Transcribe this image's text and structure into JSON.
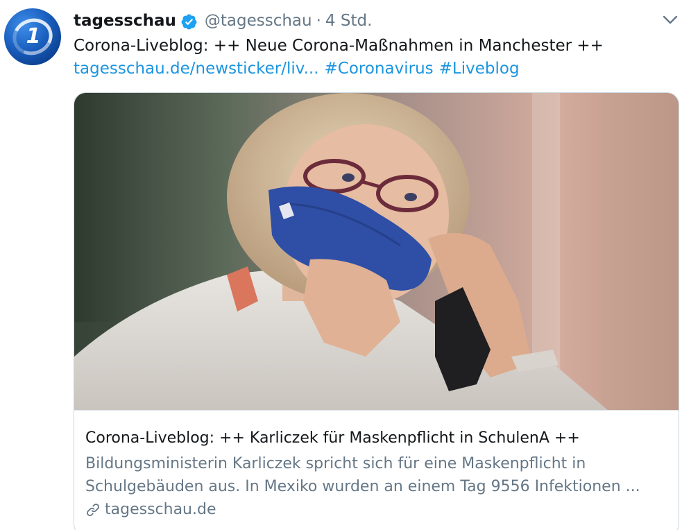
{
  "account": {
    "name": "tagesschau",
    "handle": "@tagesschau",
    "separator": "·",
    "time": "4 Std.",
    "avatar_icon": "tagesschau-logo-icon",
    "verified_icon": "verified-badge-icon"
  },
  "tweet": {
    "text": "Corona-Liveblog: ++ Neue Corona-Maßnahmen in Manchester ++",
    "link_text": "tagesschau.de/newsticker/liv...",
    "hashtags": [
      "#Coronavirus",
      "#Liveblog"
    ]
  },
  "card": {
    "image_alt_icon": "woman-with-mask-photo",
    "title": "Corona-Liveblog: ++ Karliczek für Maskenpflicht in SchulenA ++",
    "description_line1": "Bildungsministerin Karliczek spricht sich für eine Maskenpflicht in",
    "description_line2": "Schulgebäuden aus. In Mexiko wurden an einem Tag 9556 Infektionen ...",
    "domain": "tagesschau.de"
  },
  "colors": {
    "link": "#1b95e0",
    "text": "#14171a",
    "muted": "#657786",
    "verified": "#1da1f2"
  }
}
